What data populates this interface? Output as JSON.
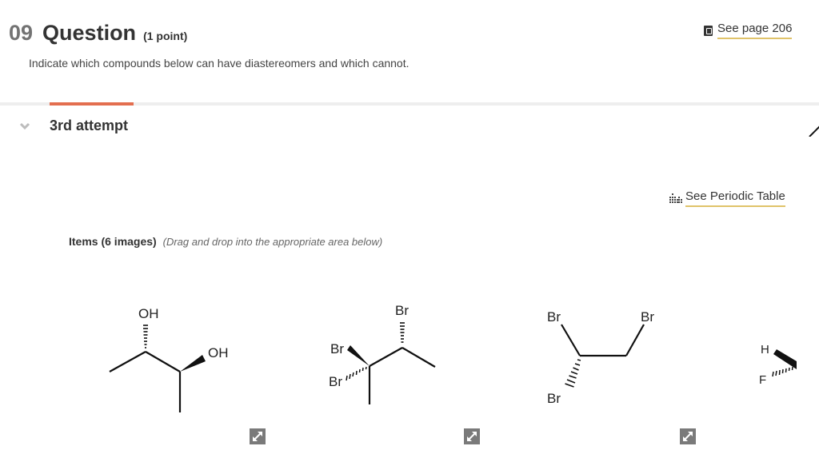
{
  "question": {
    "number": "09",
    "word": "Question",
    "points": "(1 point)",
    "instructions": "Indicate which compounds below can have diastereomers and which cannot."
  },
  "links": {
    "see_page": "See page 206",
    "see_page_icon": "book-icon",
    "periodic_table": "See Periodic Table",
    "periodic_table_icon": "periodic-table-icon"
  },
  "attempt": {
    "label": "3rd attempt",
    "icon": "chevron-down-icon"
  },
  "items": {
    "title": "Items (6 images)",
    "hint": "(Drag and drop into the appropriate area below)",
    "molecules": [
      {
        "labels": [
          "OH",
          "OH"
        ],
        "description": "butane-2,3-diol with hashed and wedged OH"
      },
      {
        "labels": [
          "Br",
          "Br",
          "Br"
        ],
        "description": "2,2,3-tribromobutane with wedge/hash Br"
      },
      {
        "labels": [
          "Br",
          "Br",
          "Br"
        ],
        "description": "1,1,2-tribromoethane with hashed Br"
      },
      {
        "labels": [
          "H",
          "F"
        ],
        "description": "partially visible molecule with wedged H and hashed F"
      }
    ],
    "expand_icon": "expand-icon"
  },
  "colors": {
    "accent": "#e36e4f",
    "link_underline": "#e0c36a",
    "text": "#333333"
  }
}
